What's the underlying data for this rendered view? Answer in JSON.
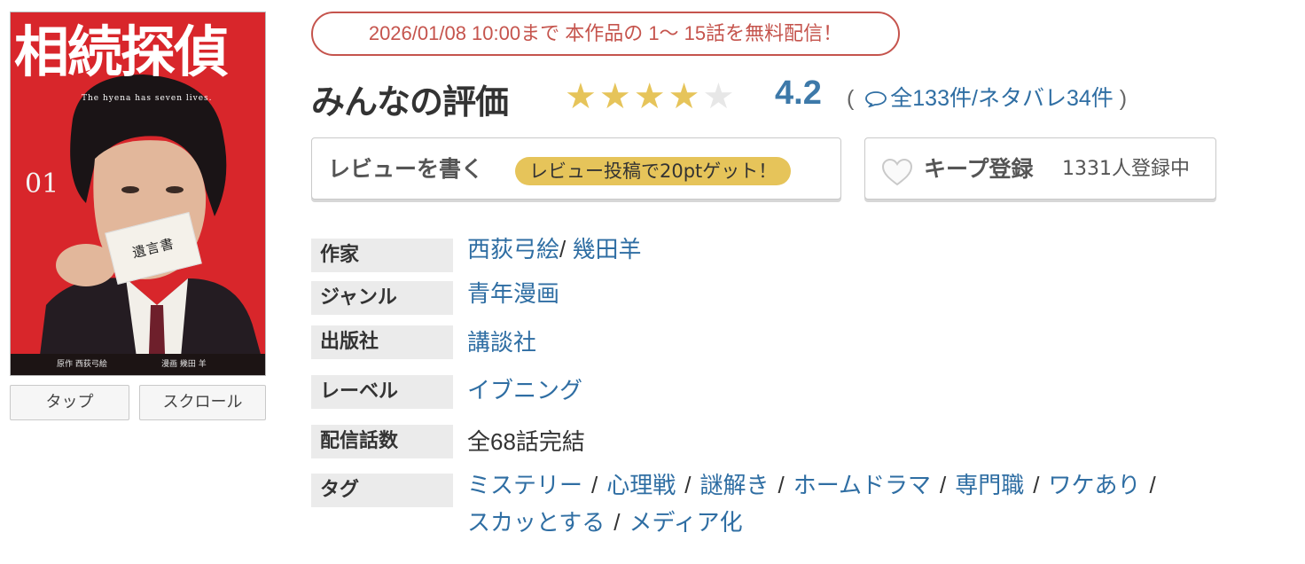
{
  "cover": {
    "title": "相続探偵",
    "subtitle": "The hyena has seven lives.",
    "volume": "01",
    "card_text": "遺言書",
    "credit_story": "原作 西荻弓絵",
    "credit_art": "漫画 幾田 羊",
    "buttons": [
      "タップ",
      "スクロール"
    ]
  },
  "campaign": "2026/01/08 10:00まで 本作品の 1〜 15話を無料配信！",
  "rating": {
    "label": "みんなの評価",
    "score": "4.2",
    "stars_filled": 4,
    "stars_total": 5,
    "open_paren": "(",
    "reviews_link": "全133件/ネタバレ34件",
    "close_paren": ")"
  },
  "review_button": {
    "label": "レビューを書く",
    "promo": "レビュー投稿で20ptゲット！"
  },
  "keep_button": {
    "label": "キープ登録",
    "count": "1331人登録中"
  },
  "info": {
    "author": {
      "label": "作家",
      "values": [
        "西荻弓絵",
        "幾田羊"
      ]
    },
    "genre": {
      "label": "ジャンル",
      "value": "青年漫画"
    },
    "publisher": {
      "label": "出版社",
      "value": "講談社"
    },
    "label_row": {
      "label": "レーベル",
      "value": "イブニング"
    },
    "episodes": {
      "label": "配信話数",
      "value": "全68話完結"
    },
    "tags": {
      "label": "タグ",
      "line1": [
        "ミステリー",
        "心理戦",
        "謎解き",
        "ホームドラマ",
        "専門職",
        "ワケあり"
      ],
      "line2": [
        "スカッとする",
        "メディア化"
      ]
    }
  },
  "colors": {
    "accent_red": "#c5544d",
    "link_blue": "#2f6ea3",
    "star_gold": "#e6c45a",
    "score_blue": "#3d79a9"
  }
}
